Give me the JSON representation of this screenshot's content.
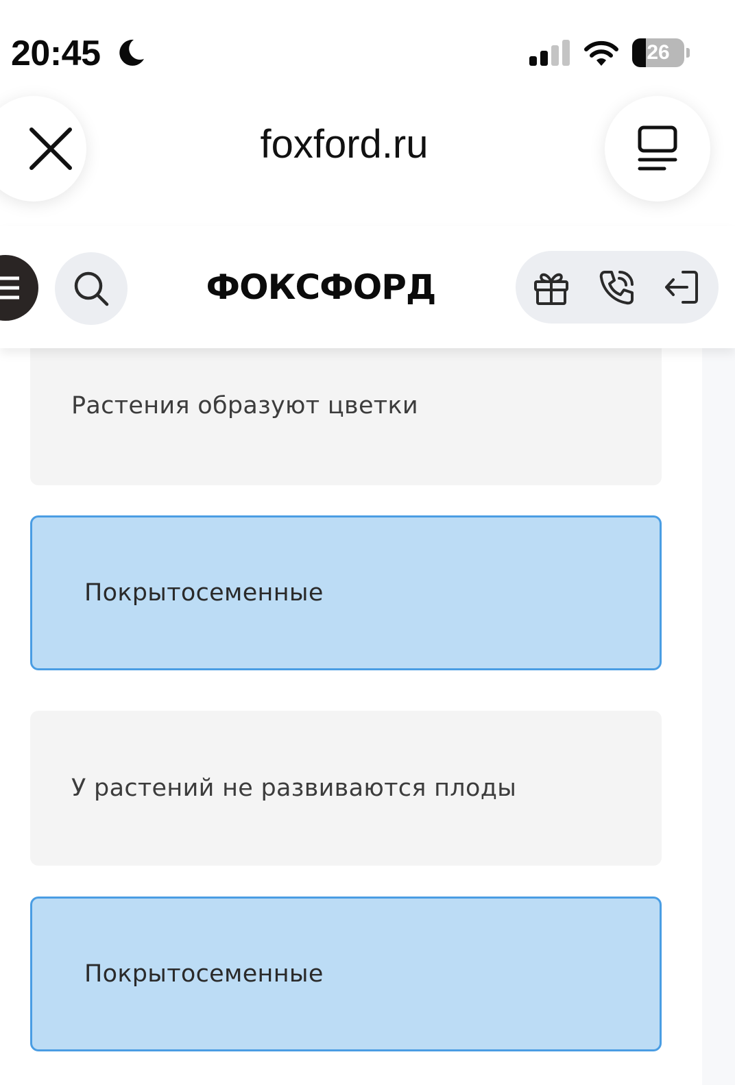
{
  "status_bar": {
    "time": "20:45",
    "moon_icon": "moon-icon",
    "signal_icon": "cellular-signal-icon",
    "signal_bars_active": 2,
    "signal_bars_total": 4,
    "wifi_icon": "wifi-icon",
    "battery_icon": "battery-icon",
    "battery_level": "26",
    "battery_fraction": 0.26
  },
  "browser": {
    "url": "foxford.ru",
    "close_icon": "close-icon",
    "menu_icon": "tabs-menu-icon"
  },
  "site_header": {
    "logo": "ФОКСФОРД",
    "hamburger_icon": "hamburger-icon",
    "search_icon": "search-icon",
    "gift_icon": "gift-icon",
    "phone_icon": "phone-icon",
    "login_icon": "login-icon"
  },
  "answers": [
    {
      "text": "Растения образуют цветки",
      "state": "default"
    },
    {
      "text": "Покрытосеменные",
      "state": "selected"
    },
    {
      "text": "У растений не развиваются плоды",
      "state": "default"
    },
    {
      "text": "Покрытосеменные",
      "state": "selected"
    }
  ],
  "colors": {
    "selected_bg": "#bcdcf5",
    "selected_border": "#4a9de3",
    "default_bg": "#f4f4f4",
    "header_pill_bg": "#eceef2",
    "hamburger_bg": "#2a2524"
  }
}
